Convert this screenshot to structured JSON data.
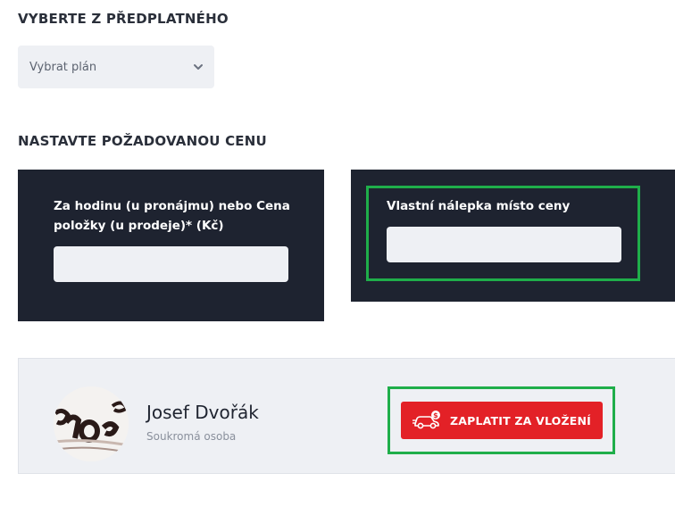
{
  "subscription": {
    "heading": "VYBERTE Z PŘEDPLATNÉHO",
    "select_value": "Vybrat plán"
  },
  "price": {
    "heading": "NASTAVTE POŽADOVANOU CENU",
    "price_label": "Za hodinu (u pronájmu) nebo Cena položky (u prodeje)* (Kč)",
    "price_value": "",
    "custom_label": "Vlastní nálepka místo ceny",
    "custom_value": ""
  },
  "profile": {
    "name": "Josef Dvořák",
    "role": "Soukromá osoba"
  },
  "pay_button": {
    "label": "ZAPLATIT ZA VLOŽENÍ"
  },
  "colors": {
    "panel": "#1e2330",
    "input": "#eef0f4",
    "highlight": "#1fae4a",
    "pay": "#e32127"
  },
  "icons": [
    "chevron-down-icon",
    "car-dollar-icon"
  ]
}
